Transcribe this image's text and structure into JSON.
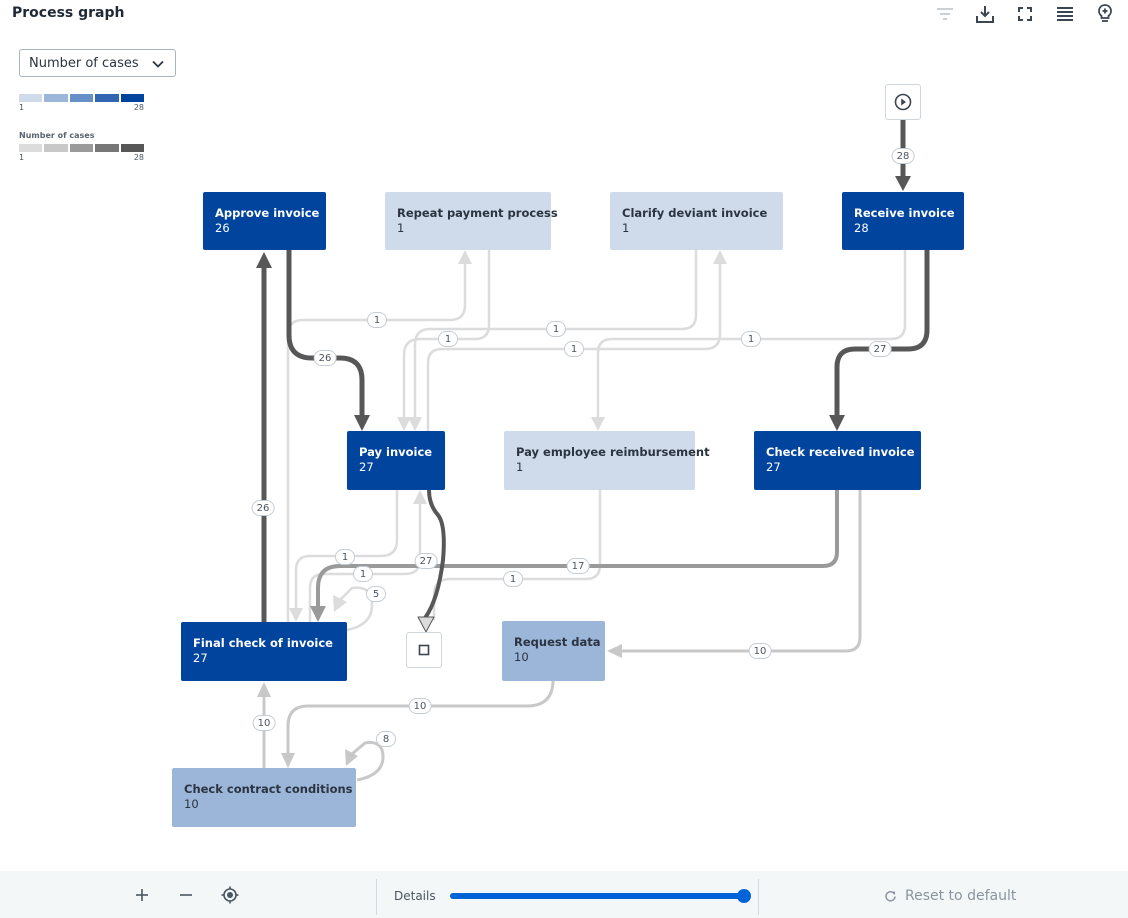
{
  "header": {
    "title": "Process graph",
    "toolbar": [
      {
        "name": "filter-icon",
        "enabled": false
      },
      {
        "name": "download-icon",
        "enabled": true
      },
      {
        "name": "fullscreen-icon",
        "enabled": true
      },
      {
        "name": "list-icon",
        "enabled": true
      },
      {
        "name": "lightbulb-icon",
        "enabled": true
      }
    ]
  },
  "metric_dropdown": {
    "selected": "Number of cases"
  },
  "legend": {
    "nodes": {
      "min": "1",
      "max": "28",
      "colors": [
        "#cfdbeb",
        "#9bb6d9",
        "#6690c7",
        "#3266b3",
        "#00449e"
      ]
    },
    "edges": {
      "title": "Number of cases",
      "min": "1",
      "max": "28",
      "colors": [
        "#dcdcdc",
        "#c8c8c8",
        "#9a9a9a",
        "#777777",
        "#575757"
      ]
    }
  },
  "graph": {
    "nodes": [
      {
        "id": "approve",
        "label": "Approve invoice",
        "count": "26"
      },
      {
        "id": "repeat",
        "label": "Repeat payment process",
        "count": "1"
      },
      {
        "id": "clarify",
        "label": "Clarify deviant invoice",
        "count": "1"
      },
      {
        "id": "receive",
        "label": "Receive invoice",
        "count": "28"
      },
      {
        "id": "pay",
        "label": "Pay invoice",
        "count": "27"
      },
      {
        "id": "reimburse",
        "label": "Pay employee reimbursement",
        "count": "1"
      },
      {
        "id": "checkreceived",
        "label": "Check received invoice",
        "count": "27"
      },
      {
        "id": "finalcheck",
        "label": "Final check of invoice",
        "count": "27"
      },
      {
        "id": "requestdata",
        "label": "Request data",
        "count": "10"
      },
      {
        "id": "contract",
        "label": "Check contract conditions",
        "count": "10"
      }
    ],
    "start": {
      "icon": "play-icon"
    },
    "end": {
      "icon": "stop-icon"
    },
    "edges": [
      {
        "from": "start",
        "to": "receive",
        "cases": "28"
      },
      {
        "from": "receive",
        "to": "checkreceived",
        "cases": "27"
      },
      {
        "from": "receive",
        "to": "reimburse",
        "cases": "1"
      },
      {
        "from": "approve",
        "to": "pay",
        "cases": "26"
      },
      {
        "from": "approve",
        "to": "repeat",
        "cases": "1"
      },
      {
        "from": "repeat",
        "to": "pay",
        "cases": "1"
      },
      {
        "from": "clarify",
        "to": "pay",
        "cases": "1"
      },
      {
        "from": "checkreceived",
        "to": "clarify",
        "cases": "1"
      },
      {
        "from": "pay",
        "to": "end",
        "cases": "27"
      },
      {
        "from": "checkreceived",
        "to": "finalcheck",
        "cases": "17"
      },
      {
        "from": "checkreceived",
        "to": "requestdata",
        "cases": "10"
      },
      {
        "from": "reimburse",
        "to": "end",
        "cases": "1"
      },
      {
        "from": "pay",
        "to": "finalcheck",
        "cases": "1"
      },
      {
        "from": "finalcheck",
        "to": "pay",
        "cases": "1"
      },
      {
        "from": "finalcheck",
        "to": "finalcheck",
        "cases": "5"
      },
      {
        "from": "finalcheck",
        "to": "approve",
        "cases": "26"
      },
      {
        "from": "requestdata",
        "to": "contract",
        "cases": "10"
      },
      {
        "from": "contract",
        "to": "finalcheck",
        "cases": "10"
      },
      {
        "from": "contract",
        "to": "contract",
        "cases": "8"
      }
    ]
  },
  "footer": {
    "zoom_in": "+",
    "zoom_out": "−",
    "details_label": "Details",
    "details_level": 1.0,
    "reset_label": "Reset to default"
  }
}
